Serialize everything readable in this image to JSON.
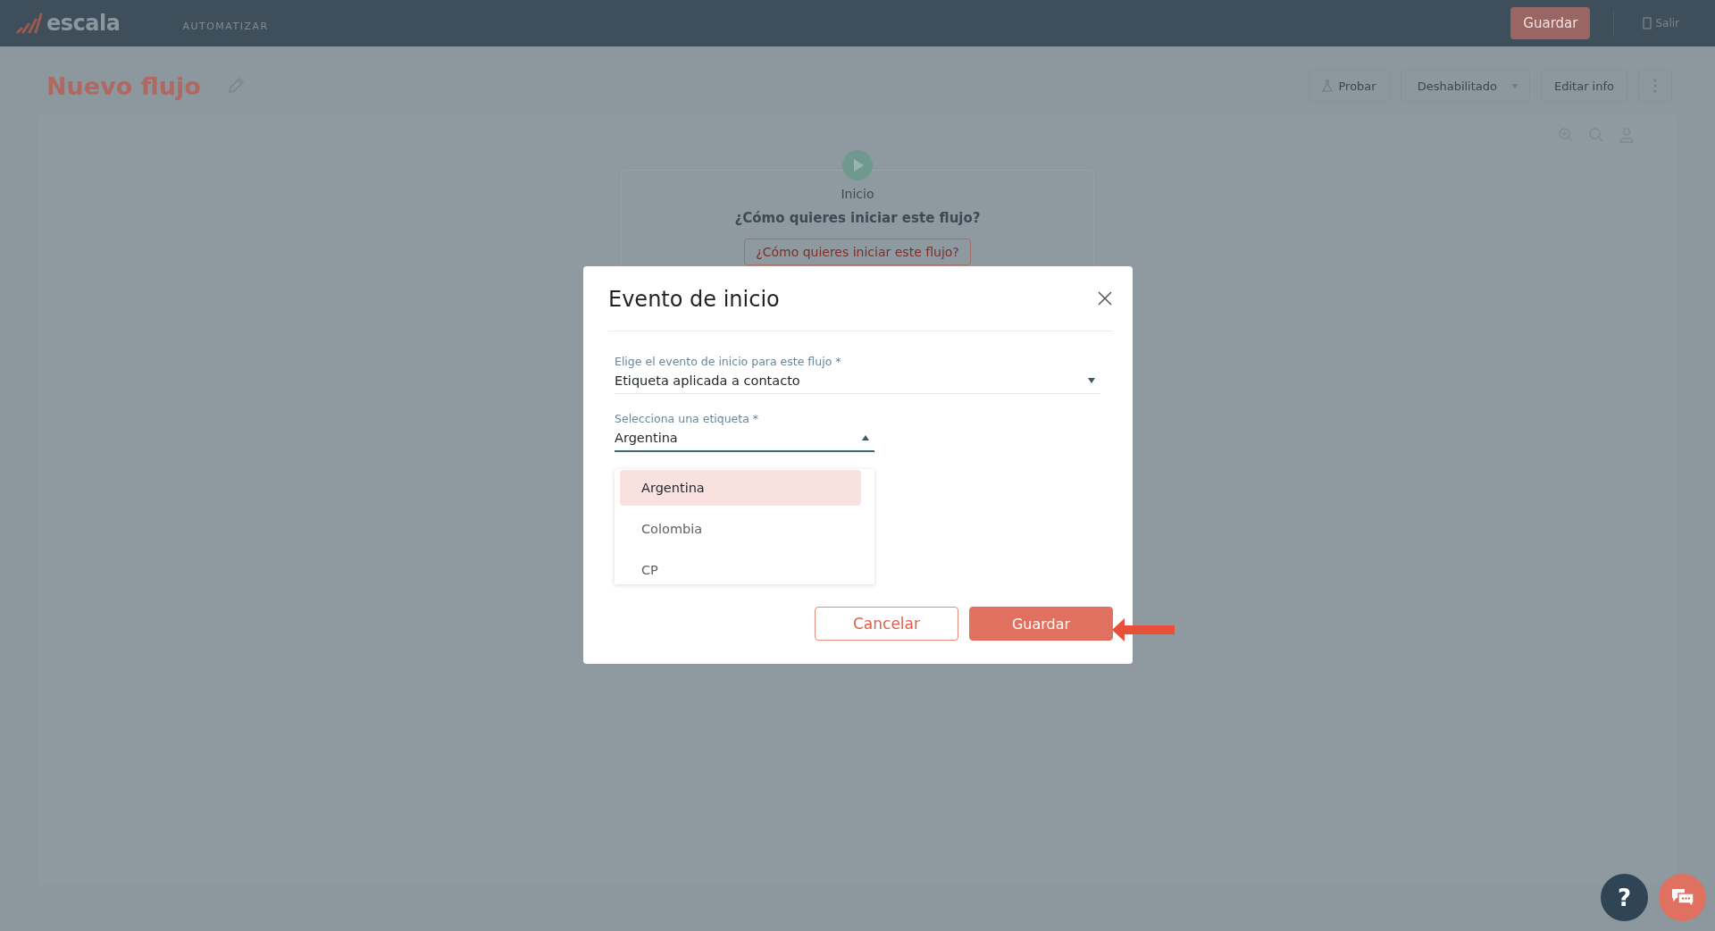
{
  "top_bar": {
    "logo": "escala",
    "section": "AUTOMATIZAR",
    "save_button": "Guardar",
    "exit_button": "Salir"
  },
  "header": {
    "title": "Nuevo flujo",
    "buttons": [
      {
        "label": "Probar",
        "kind": "icon"
      },
      {
        "label": "Deshabilitado",
        "kind": "dropdown"
      },
      {
        "label": "Editar info",
        "kind": "plain"
      }
    ]
  },
  "canvas": {
    "start_node": {
      "label": "Inicio",
      "question": "¿Cómo quieres iniciar este flujo?",
      "button": "¿Cómo quieres iniciar este flujo?"
    }
  },
  "dialog": {
    "title": "Evento de inicio",
    "fields": [
      {
        "label": "Elige el evento de inicio para este flujo *",
        "value": "Etiqueta aplicada a contacto",
        "expanded": false
      },
      {
        "label": "Selecciona una etiqueta *",
        "value": "Argentina",
        "expanded": true
      }
    ],
    "options": [
      {
        "label": "Argentina",
        "selected": true
      },
      {
        "label": "Colombia",
        "selected": false
      },
      {
        "label": "CP",
        "selected": false
      }
    ],
    "buttons": [
      {
        "label": "Cancelar",
        "kind": "secondary"
      },
      {
        "label": "Guardar",
        "kind": "primary"
      }
    ]
  },
  "help_button": "?"
}
